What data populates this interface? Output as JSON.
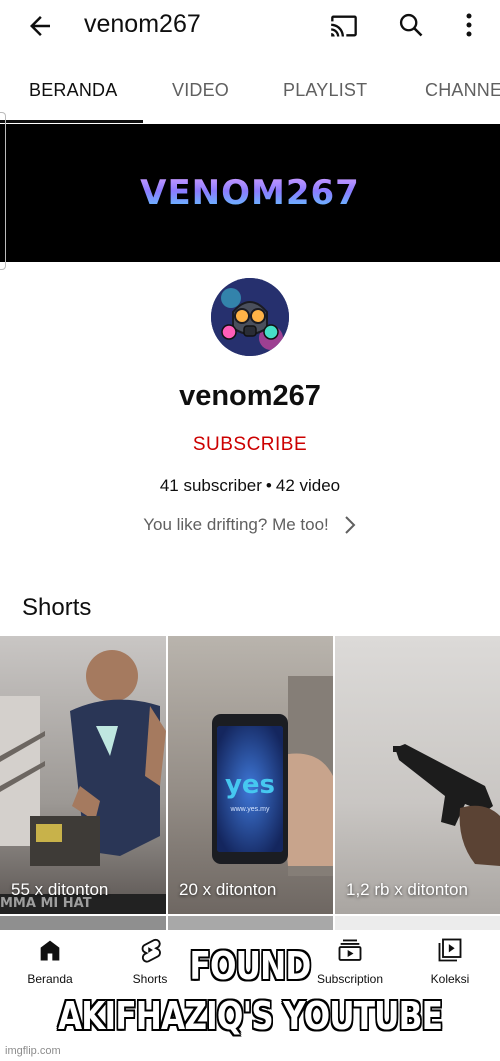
{
  "header": {
    "title": "venom267",
    "icons": [
      "back-arrow-icon",
      "cast-icon",
      "search-icon",
      "more-vert-icon"
    ]
  },
  "tabs": [
    {
      "label": "BERANDA",
      "active": true
    },
    {
      "label": "VIDEO",
      "active": false
    },
    {
      "label": "PLAYLIST",
      "active": false
    },
    {
      "label": "CHANNE",
      "active": false
    }
  ],
  "banner": {
    "text": "VENOM267"
  },
  "channel": {
    "name": "venom267",
    "subscribe_label": "SUBSCRIBE",
    "subscribers": "41 subscriber",
    "separator": "•",
    "videos": "42 video",
    "description": "You like drifting? Me too!"
  },
  "shorts": {
    "title": "Shorts",
    "items": [
      {
        "views": "55 x ditonton"
      },
      {
        "views": "20 x ditonton"
      },
      {
        "views": "1,2 rb x ditonton"
      }
    ]
  },
  "phone_screen_text": {
    "brand": "yes",
    "url": "www.yes.my"
  },
  "poster_text": "MMA MI HAT",
  "bottom_nav": [
    {
      "label": "Beranda",
      "icon": "home-icon"
    },
    {
      "label": "Shorts",
      "icon": "shorts-icon"
    },
    {
      "label": "Subscription",
      "icon": "subscriptions-icon"
    },
    {
      "label": "Koleksi",
      "icon": "library-icon"
    }
  ],
  "meme_caption": {
    "line1": "FOUND",
    "line2": "AKIFHAZIQ'S YOUTUBE"
  },
  "watermark": "imgflip.com",
  "colors": {
    "subscribe_red": "#cc0000",
    "text_dark": "#0f0f0f",
    "text_gray": "#606060",
    "banner_bg": "#000000"
  }
}
